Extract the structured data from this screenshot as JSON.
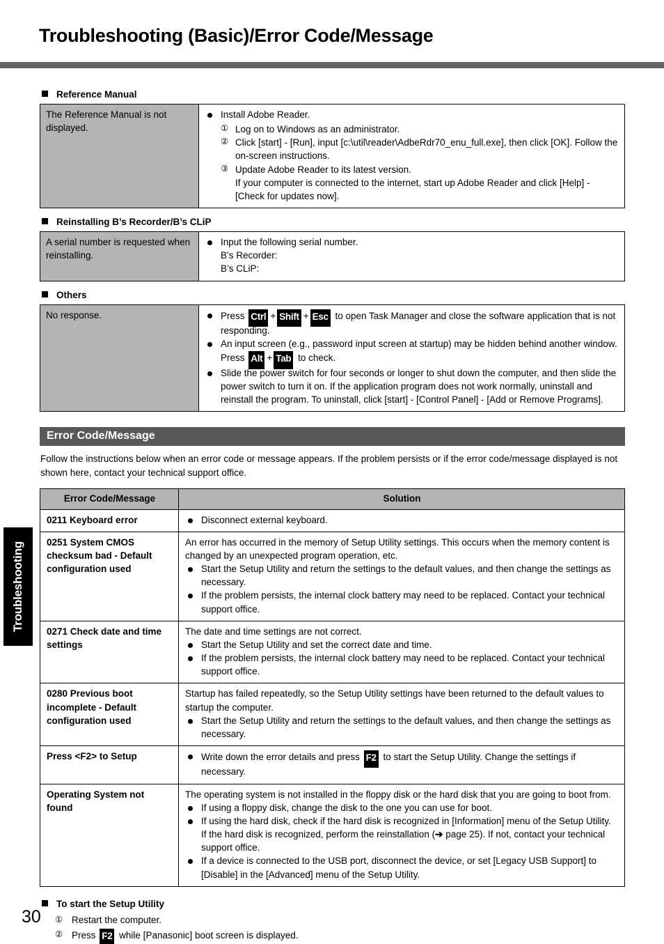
{
  "page": {
    "title": "Troubleshooting (Basic)/Error Code/Message",
    "number": "30",
    "side_tab": "Troubleshooting"
  },
  "sections": {
    "reference_manual": {
      "heading": "Reference Manual",
      "symptom": "The Reference Manual is not displayed.",
      "solution_lead": "Install Adobe Reader.",
      "steps": [
        {
          "num": "①",
          "text": "Log on to Windows as an administrator."
        },
        {
          "num": "②",
          "text": "Click [start] - [Run], input [c:\\util\\reader\\AdbeRdr70_enu_full.exe], then click [OK]. Follow the on-screen instructions."
        },
        {
          "num": "③",
          "text": "Update Adobe Reader to its latest version."
        }
      ],
      "step3_extra": "If your computer is connected to the internet, start up Adobe Reader and click [Help] - [Check for updates now]."
    },
    "reinstalling": {
      "heading": "Reinstalling B’s Recorder/B’s CLiP",
      "symptom": "A serial number is requested when reinstalling.",
      "solution_lead": "Input the following serial number.",
      "line2": "B’s Recorder:",
      "line3": "B’s CLiP:"
    },
    "others": {
      "heading": "Others",
      "symptom": "No response.",
      "bullets": [
        {
          "pre": "Press ",
          "keys": [
            "Ctrl",
            "Shift",
            "Esc"
          ],
          "post": " to open Task Manager and close the software application that is not responding."
        },
        {
          "pre": "An input screen (e.g., password input screen at startup) may be hidden behind another window. Press ",
          "keys": [
            "Alt",
            "Tab"
          ],
          "post": " to check."
        },
        {
          "pre": "Slide the power switch for four seconds or longer to shut down the computer, and then slide the power switch to turn it on. If the application program does not work normally, uninstall and reinstall the program. To uninstall, click [start] - [Control Panel] - [Add or Remove Programs].",
          "keys": [],
          "post": ""
        }
      ]
    }
  },
  "error_section": {
    "band_title": "Error Code/Message",
    "intro": "Follow the instructions below when an error code or message appears. If the problem persists or if the error code/message displayed is not shown here, contact your technical support office.",
    "columns": {
      "code": "Error Code/Message",
      "solution": "Solution"
    },
    "rows": [
      {
        "code": "0211 Keyboard error",
        "lead": "",
        "bullets": [
          "Disconnect external keyboard."
        ]
      },
      {
        "code": "0251 System CMOS checksum bad - Default configuration used",
        "lead": "An error has occurred in the memory of Setup Utility settings. This occurs when the memory content is changed by an unexpected program operation, etc.",
        "bullets": [
          "Start the Setup Utility and return the settings to the default values, and then change the settings as necessary.",
          "If the problem persists, the internal clock battery may need to be replaced. Contact your technical support office."
        ]
      },
      {
        "code": "0271 Check date and time settings",
        "lead": "The date and time settings are not correct.",
        "bullets": [
          "Start the Setup Utility and set the correct date and time.",
          "If the problem persists, the internal clock battery may need to be replaced. Contact your technical support office."
        ]
      },
      {
        "code": "0280 Previous boot incomplete - Default configuration used",
        "lead": "Startup has failed repeatedly, so the Setup Utility settings have been returned to the default values to startup the computer.",
        "bullets": [
          "Start the Setup Utility and return the settings to the default values, and then change the settings as necessary."
        ]
      }
    ],
    "row_f2": {
      "code": "Press <F2> to Setup",
      "bullet_pre": "Write down the error details and press ",
      "key": "F2",
      "bullet_post": " to start the Setup Utility. Change the settings if necessary."
    },
    "row_os": {
      "code": "Operating System not found",
      "lead": "The operating system is not installed in the floppy disk or the hard disk that you are going to boot from.",
      "bullet1": "If using a floppy disk, change the disk to the one you can use for boot.",
      "bullet2_a": "If using the hard disk, check if the hard disk is recognized in [Information] menu of the Setup Utility. If the hard disk is recognized, perform the reinstallation (",
      "bullet2_arrow": "➔",
      "bullet2_b": " page 25). If not, contact your technical support office.",
      "bullet3": "If a device is connected to the USB port, disconnect the device, or set [Legacy USB Support] to [Disable] in the [Advanced] menu of the Setup Utility."
    }
  },
  "footer": {
    "heading": "To start the Setup Utility",
    "steps": [
      {
        "num": "①",
        "pre": "Restart the computer.",
        "key": "",
        "post": ""
      },
      {
        "num": "②",
        "pre": "Press ",
        "key": "F2",
        "post": " while [Panasonic] boot screen is displayed."
      }
    ]
  },
  "colors": {
    "rule": "#656565",
    "band": "#595959",
    "cell_gray": "#b4b4b4",
    "tab": "#000000"
  }
}
